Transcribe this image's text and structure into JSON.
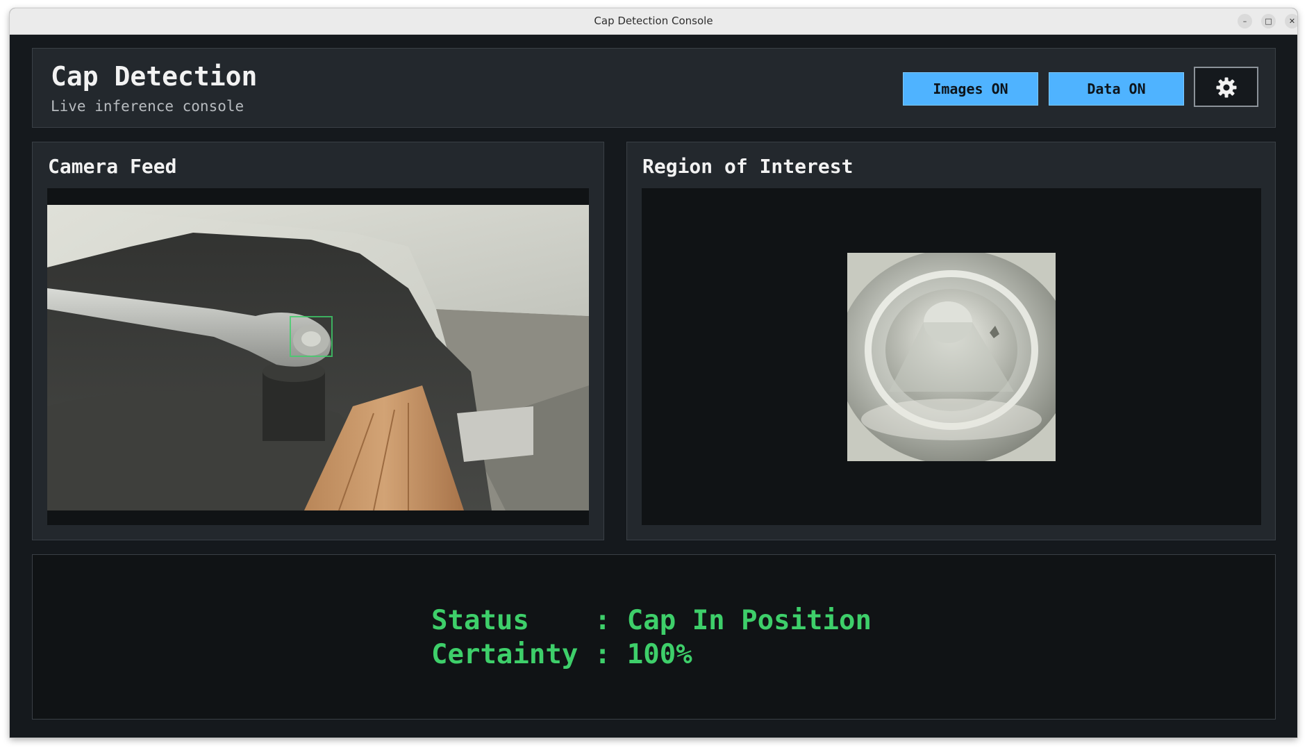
{
  "window": {
    "title": "Cap Detection Console",
    "controls": {
      "minimize": "–",
      "maximize": "□",
      "close": "✕"
    }
  },
  "header": {
    "title": "Cap Detection",
    "subtitle": "Live inference console",
    "images_toggle": "Images ON",
    "data_toggle": "Data ON",
    "settings_icon": "gear-icon"
  },
  "camera": {
    "title": "Camera Feed"
  },
  "roi": {
    "title": "Region of Interest"
  },
  "status": {
    "status_label": "Status    ",
    "status_value": "Cap In Position",
    "certainty_label": "Certainty ",
    "certainty_value": "100%",
    "separator": ": "
  },
  "colors": {
    "accent": "#4fb3ff",
    "status_text": "#3ecf6a",
    "panel_bg": "#23282d",
    "window_bg": "#15191d"
  }
}
